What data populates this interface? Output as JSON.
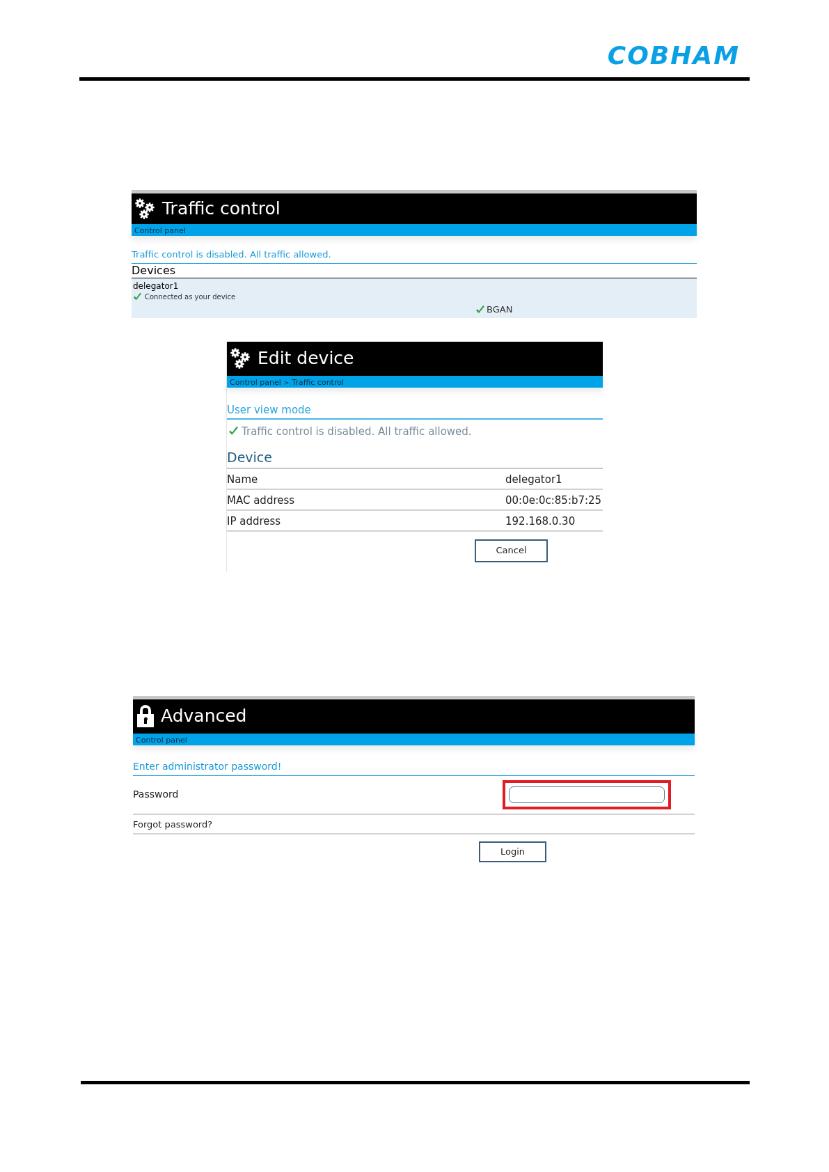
{
  "logo": "COBHAM",
  "traffic_control": {
    "title": "Traffic control",
    "breadcrumb": [
      "Control panel"
    ],
    "message": "Traffic control is disabled. All traffic allowed.",
    "section": "Devices",
    "devices": [
      {
        "name": "delegator1",
        "status": "Connected as your device",
        "connection": "BGAN"
      }
    ]
  },
  "edit_device": {
    "title": "Edit device",
    "breadcrumb": [
      "Control panel",
      "Traffic control"
    ],
    "breadcrumb_separator": ">",
    "mode": "User view mode",
    "message": "Traffic control is disabled. All traffic allowed.",
    "section": "Device",
    "rows": [
      {
        "label": "Name",
        "value": "delegator1"
      },
      {
        "label": "MAC address",
        "value": "00:0e:0c:85:b7:25"
      },
      {
        "label": "IP address",
        "value": "192.168.0.30"
      }
    ],
    "button": "Cancel"
  },
  "advanced": {
    "title": "Advanced",
    "breadcrumb": [
      "Control panel"
    ],
    "message": "Enter administrator password!",
    "field_label": "Password",
    "field_highlighted": true,
    "link": "Forgot password?",
    "button": "Login"
  }
}
